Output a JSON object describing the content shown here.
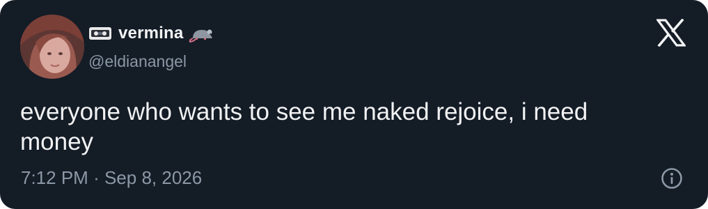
{
  "author": {
    "display_name": "vermina",
    "handle": "@eldianangel",
    "name_emojis": [
      "vhs-cassette-icon",
      "rat-icon"
    ]
  },
  "tweet": {
    "text": "everyone who wants to see me naked rejoice, i need money",
    "time": "7:12 PM",
    "separator": "·",
    "date": "Sep 8, 2026"
  },
  "icons": {
    "brand": "x-logo-icon",
    "info": "info-icon"
  },
  "colors": {
    "background": "#141c26",
    "text_primary": "#f1f2f3",
    "text_secondary": "#8b98a5"
  }
}
